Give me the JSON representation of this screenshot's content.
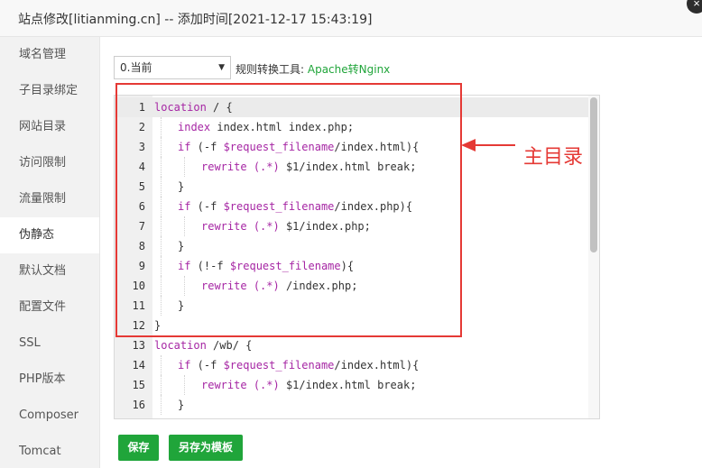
{
  "dialog": {
    "title": "站点修改[litianming.cn] -- 添加时间[2021-12-17 15:43:19]",
    "close_symbol": "×"
  },
  "sidebar": {
    "items": [
      {
        "label": "域名管理"
      },
      {
        "label": "子目录绑定"
      },
      {
        "label": "网站目录"
      },
      {
        "label": "访问限制"
      },
      {
        "label": "流量限制"
      },
      {
        "label": "伪静态",
        "active": true
      },
      {
        "label": "默认文档"
      },
      {
        "label": "配置文件"
      },
      {
        "label": "SSL"
      },
      {
        "label": "PHP版本"
      },
      {
        "label": "Composer"
      },
      {
        "label": "Tomcat"
      }
    ]
  },
  "toolbar": {
    "select_value": "0.当前",
    "tool_label": "规则转换工具:",
    "tool_link": "Apache转Nginx"
  },
  "editor": {
    "lines": [
      {
        "n": "1",
        "indent": 0,
        "segs": [
          [
            "kw",
            "location"
          ],
          [
            "",
            " / {"
          ]
        ]
      },
      {
        "n": "2",
        "indent": 1,
        "segs": [
          [
            "kw",
            "index"
          ],
          [
            "",
            " index.html index.php;"
          ]
        ]
      },
      {
        "n": "3",
        "indent": 1,
        "segs": [
          [
            "kw",
            "if"
          ],
          [
            "",
            " (-f "
          ],
          [
            "var",
            "$request_filename"
          ],
          [
            "",
            "/index.html){"
          ]
        ]
      },
      {
        "n": "4",
        "indent": 2,
        "segs": [
          [
            "kw",
            "rewrite"
          ],
          [
            "",
            " "
          ],
          [
            "kw",
            "(.*)"
          ],
          [
            "",
            " $1/index.html break;"
          ]
        ]
      },
      {
        "n": "5",
        "indent": 1,
        "segs": [
          [
            "",
            "}"
          ]
        ]
      },
      {
        "n": "6",
        "indent": 1,
        "segs": [
          [
            "kw",
            "if"
          ],
          [
            "",
            " (-f "
          ],
          [
            "var",
            "$request_filename"
          ],
          [
            "",
            "/index.php){"
          ]
        ]
      },
      {
        "n": "7",
        "indent": 2,
        "segs": [
          [
            "kw",
            "rewrite"
          ],
          [
            "",
            " "
          ],
          [
            "kw",
            "(.*)"
          ],
          [
            "",
            " $1/index.php;"
          ]
        ]
      },
      {
        "n": "8",
        "indent": 1,
        "segs": [
          [
            "",
            "}"
          ]
        ]
      },
      {
        "n": "9",
        "indent": 1,
        "segs": [
          [
            "kw",
            "if"
          ],
          [
            "",
            " (!-f "
          ],
          [
            "var",
            "$request_filename"
          ],
          [
            "",
            "){"
          ]
        ]
      },
      {
        "n": "10",
        "indent": 2,
        "segs": [
          [
            "kw",
            "rewrite"
          ],
          [
            "",
            " "
          ],
          [
            "kw",
            "(.*)"
          ],
          [
            "",
            " /index.php;"
          ]
        ]
      },
      {
        "n": "11",
        "indent": 1,
        "segs": [
          [
            "",
            "}"
          ]
        ]
      },
      {
        "n": "12",
        "indent": 0,
        "segs": [
          [
            "",
            "}"
          ]
        ]
      },
      {
        "n": "13",
        "indent": 0,
        "segs": [
          [
            "kw",
            "location"
          ],
          [
            "",
            " /wb/ {"
          ]
        ]
      },
      {
        "n": "14",
        "indent": 1,
        "segs": [
          [
            "kw",
            "if"
          ],
          [
            "",
            " (-f "
          ],
          [
            "var",
            "$request_filename"
          ],
          [
            "",
            "/index.html){"
          ]
        ]
      },
      {
        "n": "15",
        "indent": 2,
        "segs": [
          [
            "kw",
            "rewrite"
          ],
          [
            "",
            " "
          ],
          [
            "kw",
            "(.*)"
          ],
          [
            "",
            " $1/index.html break;"
          ]
        ]
      },
      {
        "n": "16",
        "indent": 1,
        "segs": [
          [
            "",
            "}"
          ]
        ]
      }
    ]
  },
  "annotation": {
    "text": "主目录",
    "color": "#e53935"
  },
  "buttons": {
    "save": "保存",
    "save_as_template": "另存为模板"
  },
  "colors": {
    "accent": "#20a53a",
    "keyword": "#a626a4"
  }
}
